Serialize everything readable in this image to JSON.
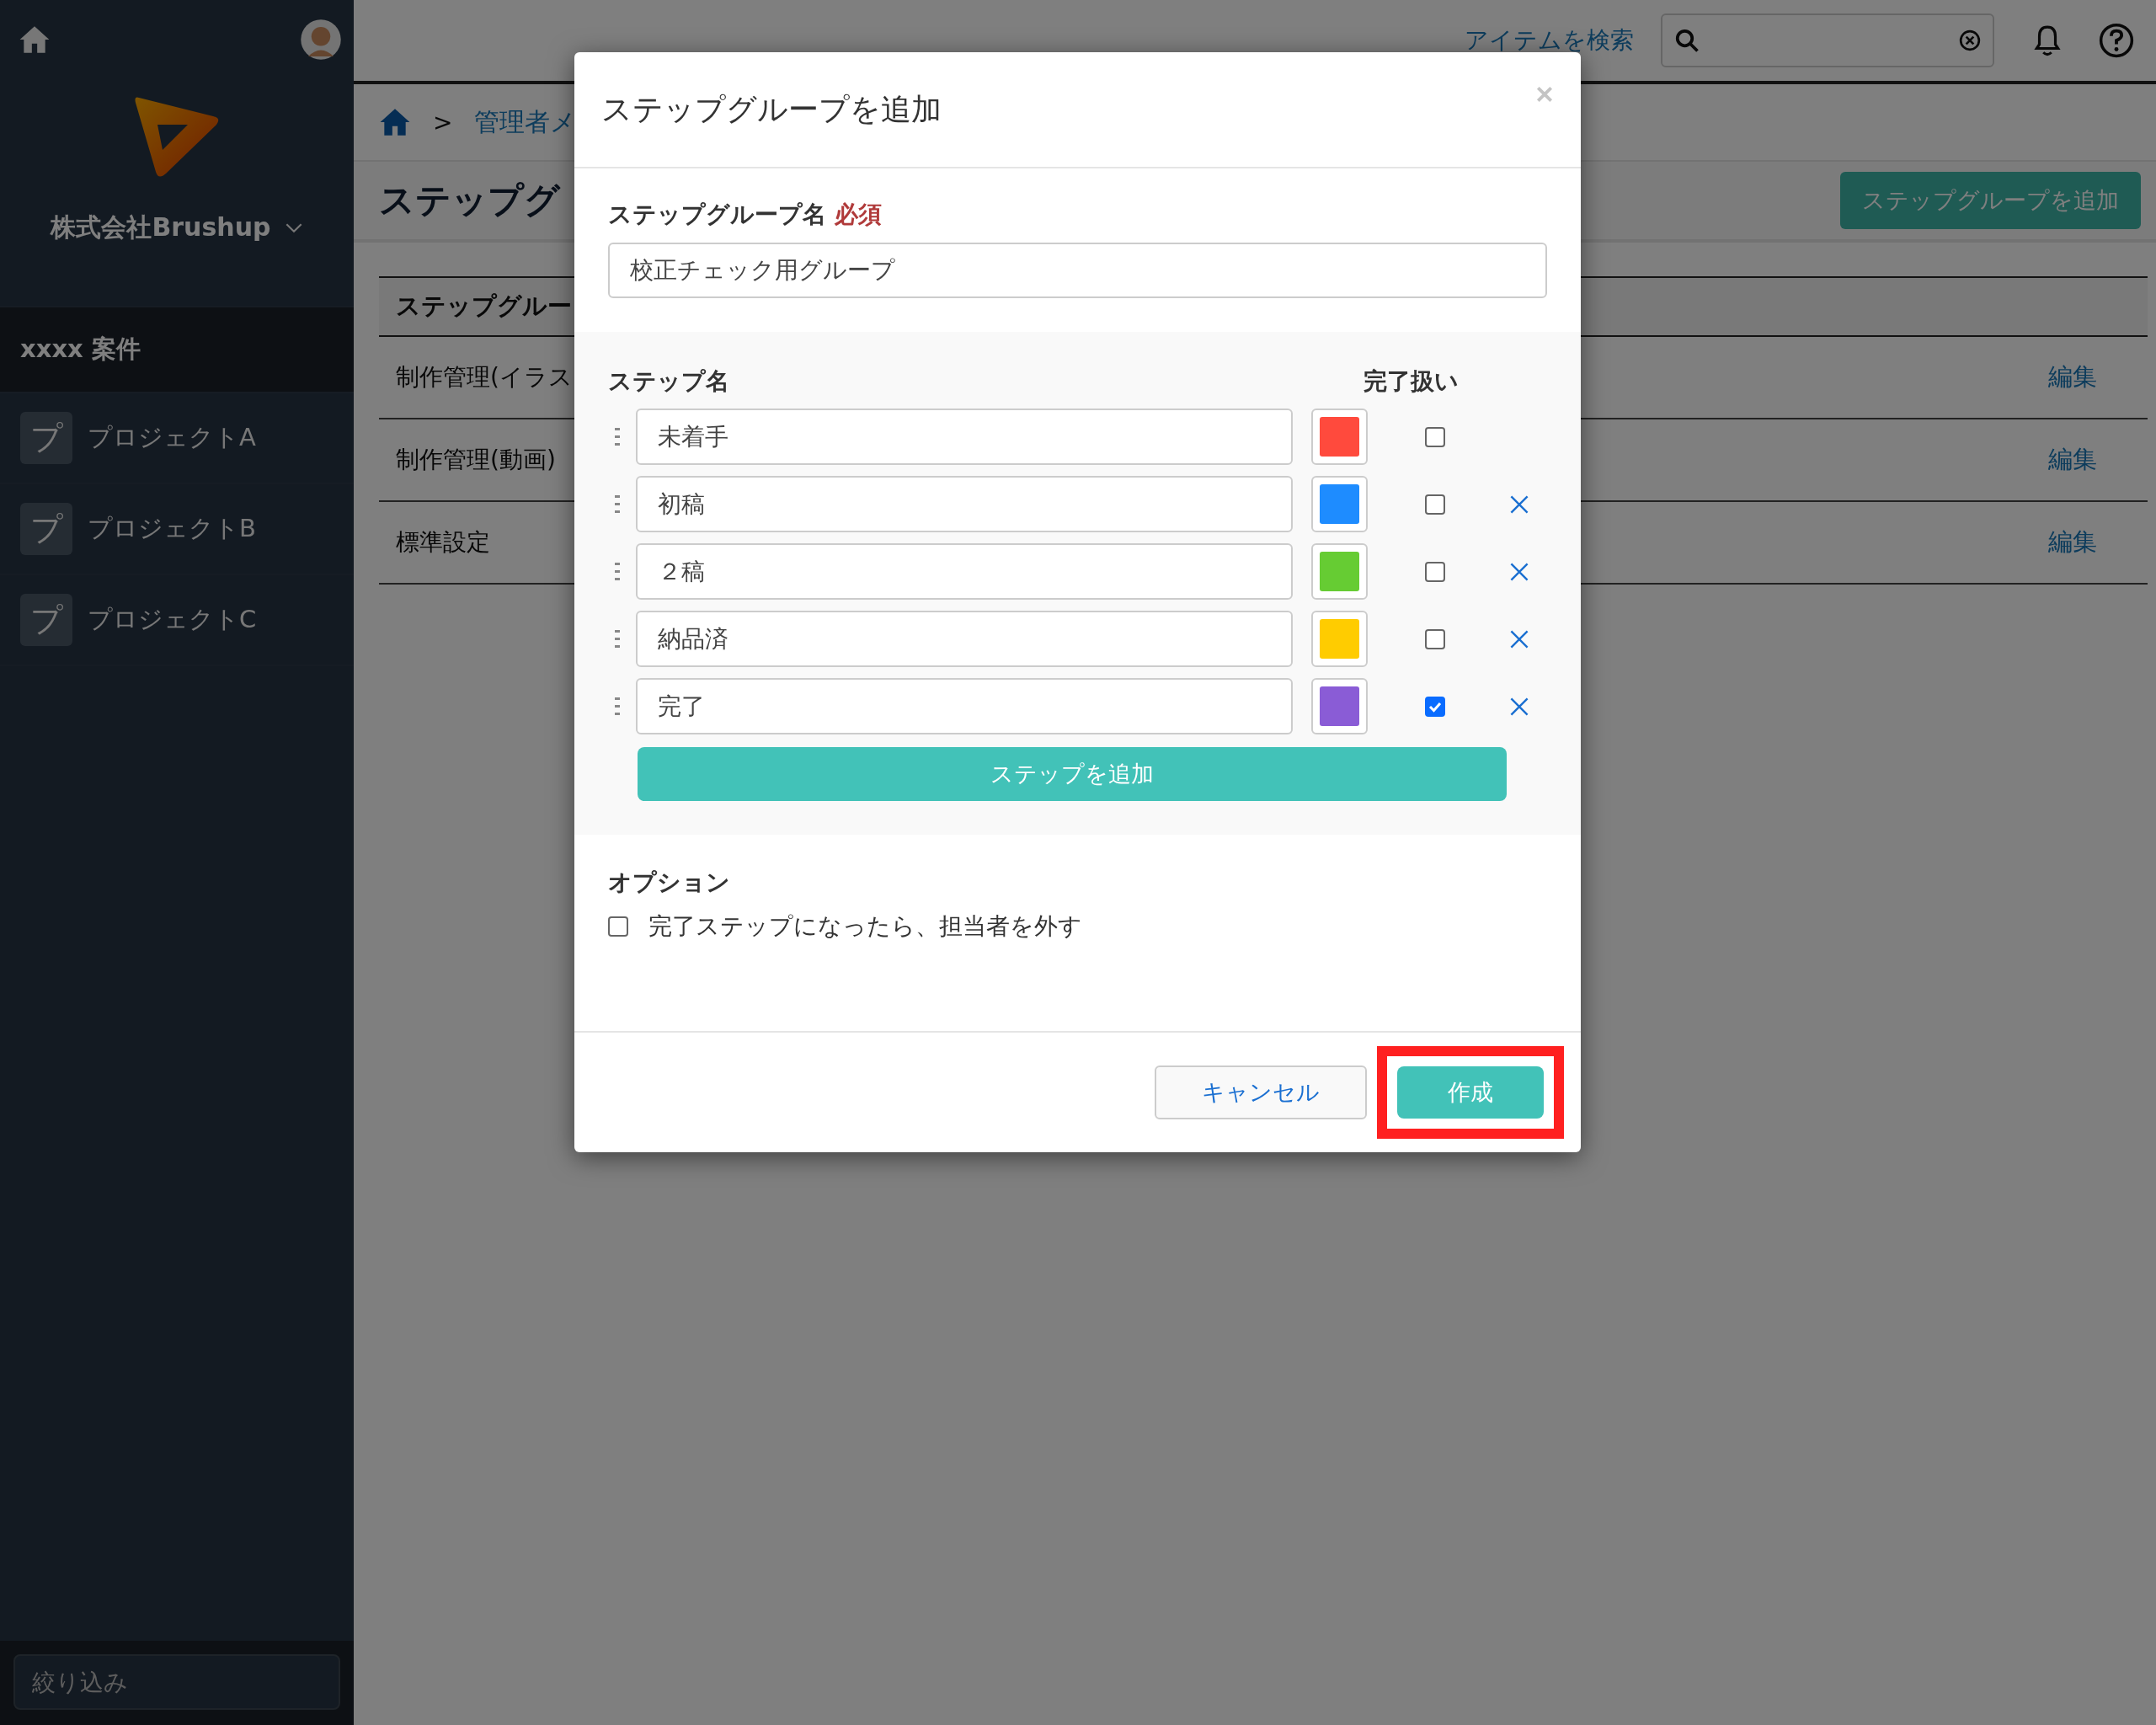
{
  "sidebar": {
    "company": "株式会社Brushup",
    "section": "xxxx 案件",
    "projects": [
      {
        "icon": "プ",
        "name": "プロジェクトA"
      },
      {
        "icon": "プ",
        "name": "プロジェクトB"
      },
      {
        "icon": "プ",
        "name": "プロジェクトC"
      }
    ],
    "filter": {
      "placeholder": "絞り込み"
    }
  },
  "header": {
    "search_link": "アイテムを検索"
  },
  "breadcrumb": {
    "separator": ">",
    "link": "管理者メ"
  },
  "page_title": "ステップグ",
  "add_group_button": "ステップグループを追加",
  "table": {
    "column": "ステップグルー",
    "rows": [
      {
        "name": "制作管理(イラス",
        "action": "編集"
      },
      {
        "name": "制作管理(動画)",
        "action": "編集"
      },
      {
        "name": "標準設定",
        "action": "編集"
      }
    ]
  },
  "dialog": {
    "title": "ステップグループを追加",
    "name_label": "ステップグループ名",
    "required": "必須",
    "name_value": "校正チェック用グループ",
    "steps_label": "ステップ名",
    "done_label": "完了扱い",
    "steps": [
      {
        "name": "未着手",
        "color": "#ff4a3d",
        "done": false,
        "removable": false
      },
      {
        "name": "初稿",
        "color": "#1e8cff",
        "done": false,
        "removable": true
      },
      {
        "name": "２稿",
        "color": "#66cc33",
        "done": false,
        "removable": true
      },
      {
        "name": "納品済",
        "color": "#ffcc00",
        "done": false,
        "removable": true
      },
      {
        "name": "完了",
        "color": "#8a5cd6",
        "done": true,
        "removable": true
      }
    ],
    "add_step": "ステップを追加",
    "options_label": "オプション",
    "options": [
      {
        "label": "完了ステップになったら、担当者を外す",
        "checked": false
      }
    ],
    "cancel": "キャンセル",
    "create": {
      "label": "作成",
      "highlighted": true
    }
  }
}
